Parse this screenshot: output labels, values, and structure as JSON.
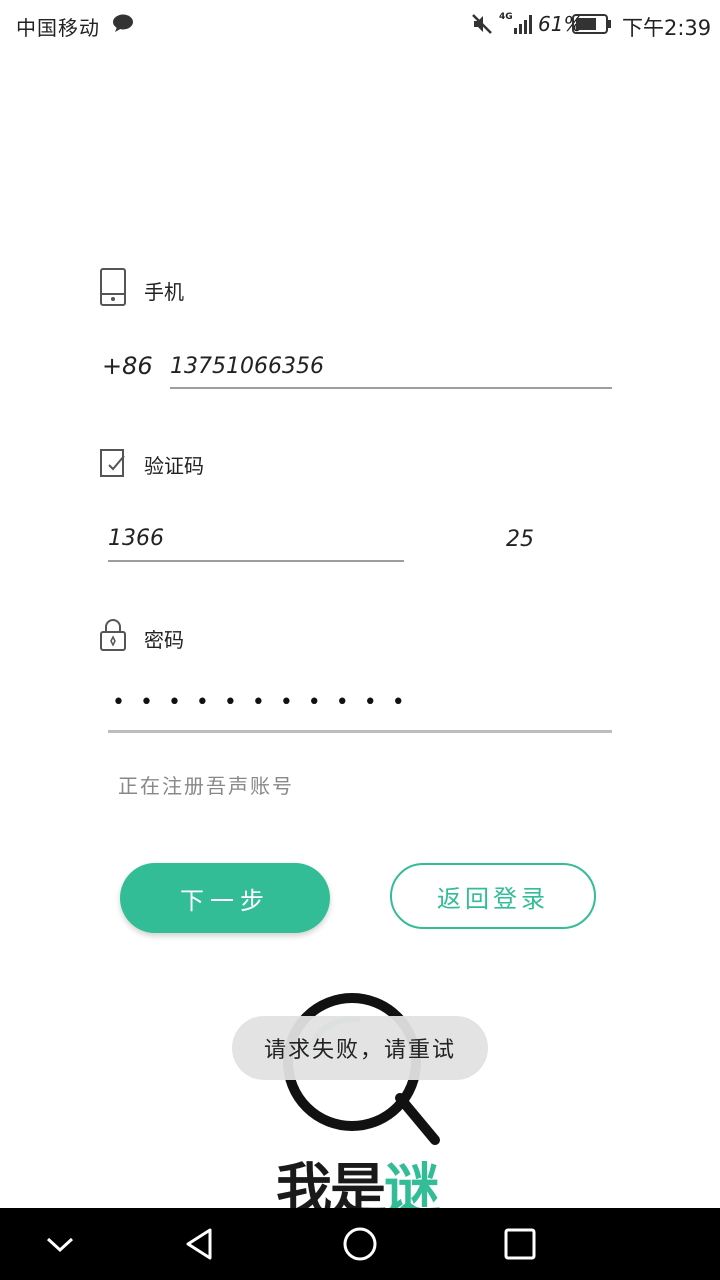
{
  "status_bar": {
    "carrier": "中国移动",
    "network": "4G",
    "battery_percent": "61%",
    "time": "下午2:39",
    "icons": [
      "message-icon",
      "mute-icon",
      "signal-icon",
      "battery-icon"
    ]
  },
  "phone": {
    "label": "手机",
    "country_code": "+86",
    "value": "13751066356"
  },
  "code": {
    "label": "验证码",
    "value": "1366",
    "countdown": "25"
  },
  "password": {
    "label": "密码",
    "masked_value": "• • • • • • • • • • •"
  },
  "registering_text": "正在注册吾声账号",
  "buttons": {
    "next": "下一步",
    "back_to_login": "返回登录"
  },
  "toast": "请求失败，请重试",
  "logo": {
    "text_main": "我是",
    "text_accent": "谜"
  },
  "colors": {
    "accent": "#33bd97",
    "underline": "#9e9e9e",
    "nav_bar": "#000000"
  }
}
